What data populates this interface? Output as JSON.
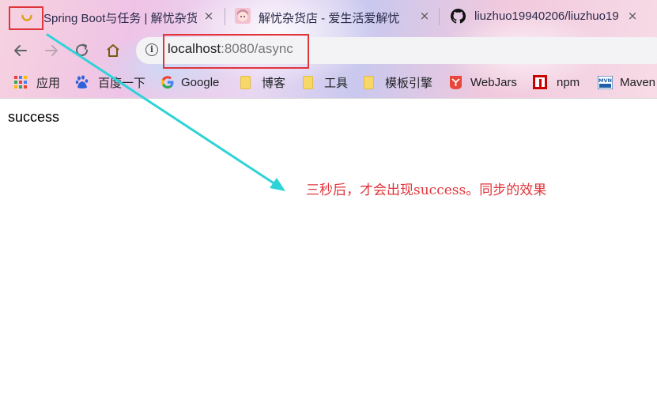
{
  "tabs": [
    {
      "title": "Spring Boot与任务 | 解忧杂货",
      "icon": "loading-spinner-icon",
      "active": true
    },
    {
      "title": "解忧杂货店 - 爱生活爱解忧",
      "icon": "anime-avatar-icon"
    },
    {
      "title": "liuzhuo19940206/liuzhuo19",
      "icon": "github-icon"
    }
  ],
  "tab_close_glyph": "×",
  "address_bar": {
    "host": "localhost",
    "rest": ":8080/async",
    "icon": "info-icon"
  },
  "nav": {
    "back": "back-arrow-icon",
    "forward": "forward-arrow-icon",
    "reload": "reload-icon",
    "home": "home-icon"
  },
  "bookmarks": [
    {
      "label": "应用",
      "icon": "apps-grid-icon"
    },
    {
      "label": "百度一下",
      "icon": "baidu-paw-icon"
    },
    {
      "label": "Google",
      "icon": "google-g-icon"
    },
    {
      "label": "博客",
      "icon": "folder-icon"
    },
    {
      "label": "工具",
      "icon": "folder-icon"
    },
    {
      "label": "模板引擎",
      "icon": "folder-icon"
    },
    {
      "label": "WebJars",
      "icon": "webjars-icon"
    },
    {
      "label": "npm",
      "icon": "npm-icon"
    },
    {
      "label": "Maven",
      "icon": "maven-icon"
    }
  ],
  "page": {
    "body_text": "success"
  },
  "annotation": {
    "text": "三秒后，才会出现success。同步的效果",
    "color": "#e0353a"
  },
  "colors": {
    "highlight_box": "#e0353a",
    "arrow": "#2ed3d8"
  }
}
